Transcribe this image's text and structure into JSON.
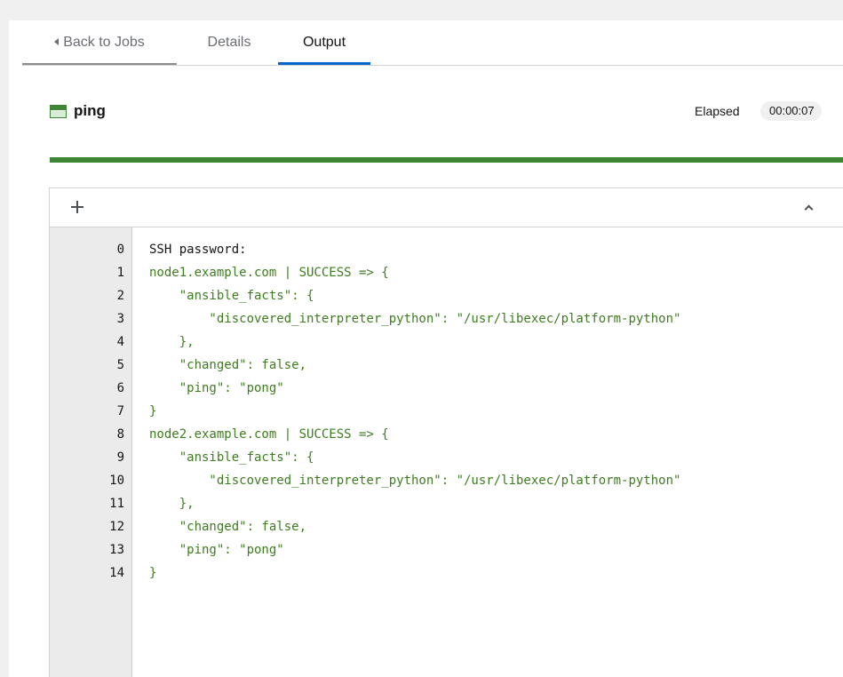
{
  "tabs": {
    "back_label": "Back to Jobs",
    "details_label": "Details",
    "output_label": "Output"
  },
  "job": {
    "name": "ping",
    "status": "success",
    "elapsed_label": "Elapsed",
    "elapsed_value": "00:00:07",
    "progress_percent": 100
  },
  "colors": {
    "success": "#3e8635",
    "active_tab": "#0066cc",
    "output_text": "#3e7d1f"
  },
  "icons": {
    "expand": "plus-icon",
    "collapse": "chevron-up-icon",
    "status": "success-status-icon",
    "back": "caret-left-icon"
  },
  "output": {
    "lines": [
      {
        "n": "0",
        "text": "SSH password:"
      },
      {
        "n": "1",
        "text": "node1.example.com | SUCCESS => {"
      },
      {
        "n": "2",
        "text": "    \"ansible_facts\": {"
      },
      {
        "n": "3",
        "text": "        \"discovered_interpreter_python\": \"/usr/libexec/platform-python\""
      },
      {
        "n": "4",
        "text": "    },"
      },
      {
        "n": "5",
        "text": "    \"changed\": false,"
      },
      {
        "n": "6",
        "text": "    \"ping\": \"pong\""
      },
      {
        "n": "7",
        "text": "}"
      },
      {
        "n": "8",
        "text": "node2.example.com | SUCCESS => {"
      },
      {
        "n": "9",
        "text": "    \"ansible_facts\": {"
      },
      {
        "n": "10",
        "text": "        \"discovered_interpreter_python\": \"/usr/libexec/platform-python\""
      },
      {
        "n": "11",
        "text": "    },"
      },
      {
        "n": "12",
        "text": "    \"changed\": false,"
      },
      {
        "n": "13",
        "text": "    \"ping\": \"pong\""
      },
      {
        "n": "14",
        "text": "}"
      }
    ]
  }
}
